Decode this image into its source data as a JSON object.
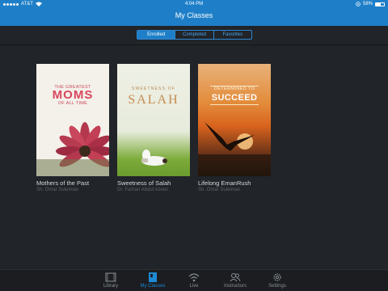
{
  "status_bar": {
    "carrier": "AT&T",
    "time": "4:04 PM",
    "battery": "58%"
  },
  "nav": {
    "title": "My Classes"
  },
  "segments": [
    {
      "label": "Enrolled",
      "active": true
    },
    {
      "label": "Completed",
      "active": false
    },
    {
      "label": "Favorites",
      "active": false
    }
  ],
  "classes": [
    {
      "title": "Mothers of the Past",
      "author": "Sh. Omar Suleiman",
      "cover_lines": [
        "THE GREATEST",
        "MOMS",
        "OF ALL TIME"
      ]
    },
    {
      "title": "Sweetness of Salah",
      "author": "Dr. Farhan Abdul Azeez",
      "cover_lines": [
        "SWEETNESS OF",
        "SALAH"
      ]
    },
    {
      "title": "Lifelong EmanRush",
      "author": "Sh. Omar Suleiman",
      "cover_lines": [
        "DETERMINED TO",
        "SUCCEED"
      ]
    }
  ],
  "tabs": [
    {
      "label": "Library",
      "icon": "film-icon",
      "active": false
    },
    {
      "label": "My Classes",
      "icon": "my-classes-icon",
      "active": true
    },
    {
      "label": "Live",
      "icon": "wifi-icon",
      "active": false
    },
    {
      "label": "Instructors",
      "icon": "people-icon",
      "active": false
    },
    {
      "label": "Settings",
      "icon": "gear-icon",
      "active": false
    }
  ],
  "colors": {
    "brand": "#1e7fc8",
    "background": "#212428",
    "tab_active": "#1e8ad6"
  }
}
